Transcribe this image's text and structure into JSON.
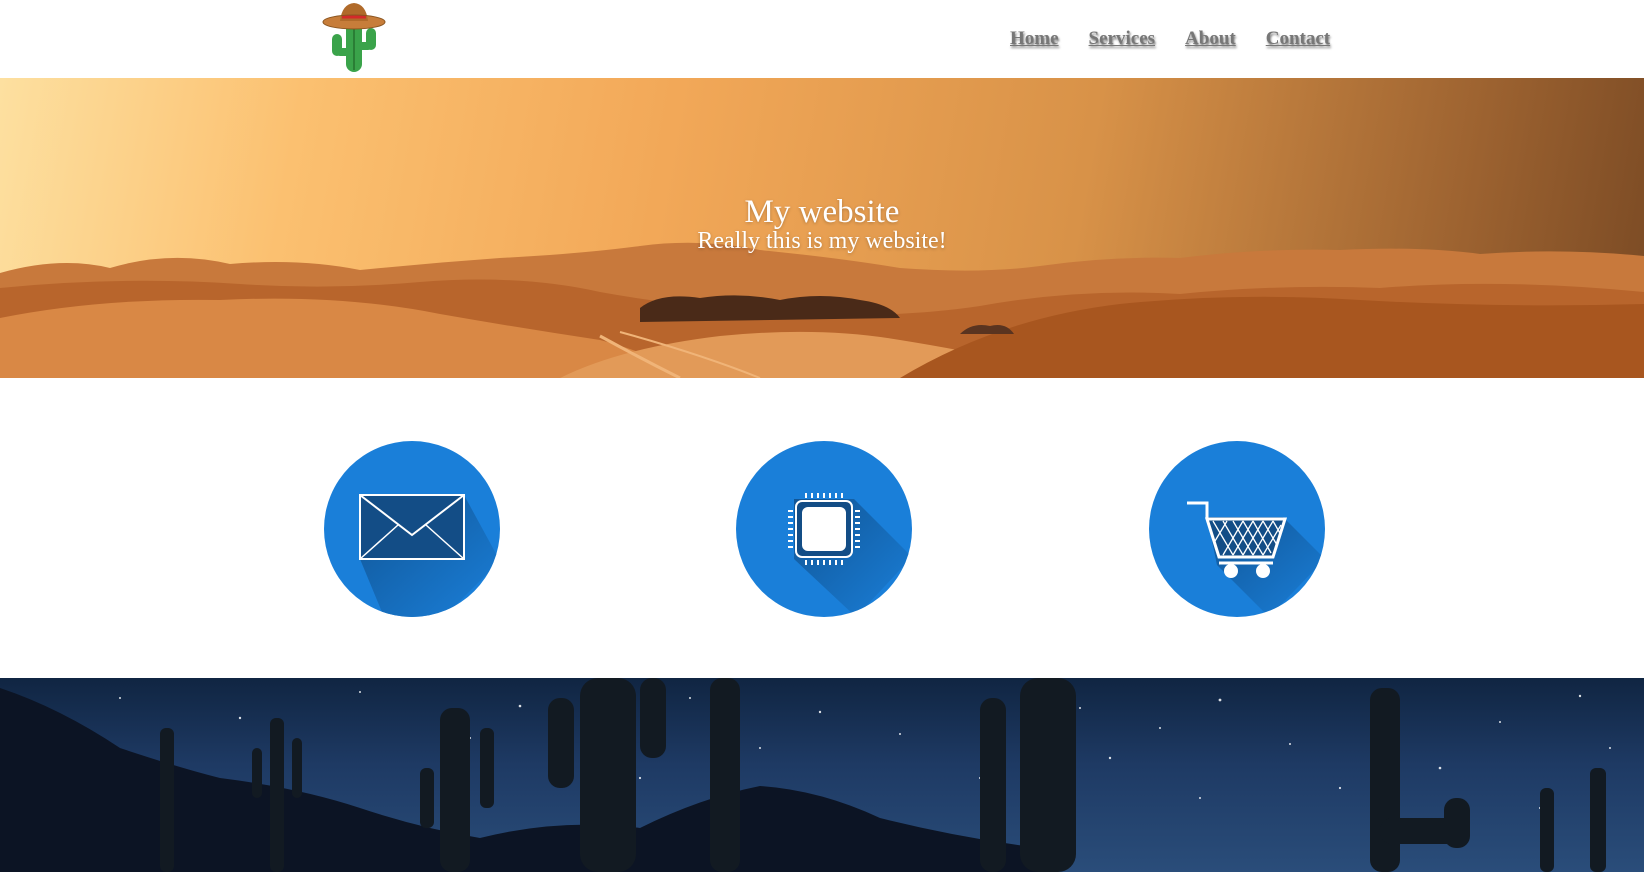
{
  "header": {
    "logo_icon": "cactus-sombrero-logo",
    "nav": [
      "Home",
      "Services",
      "About",
      "Contact"
    ]
  },
  "hero": {
    "title": "My website",
    "subtitle": "Really this is my website!"
  },
  "services": {
    "icons": [
      "envelope-icon",
      "cpu-chip-icon",
      "shopping-cart-icon"
    ],
    "accent": "#1a7fd9"
  },
  "footer_banner": {
    "image": "night-sky-cactus-photo"
  }
}
